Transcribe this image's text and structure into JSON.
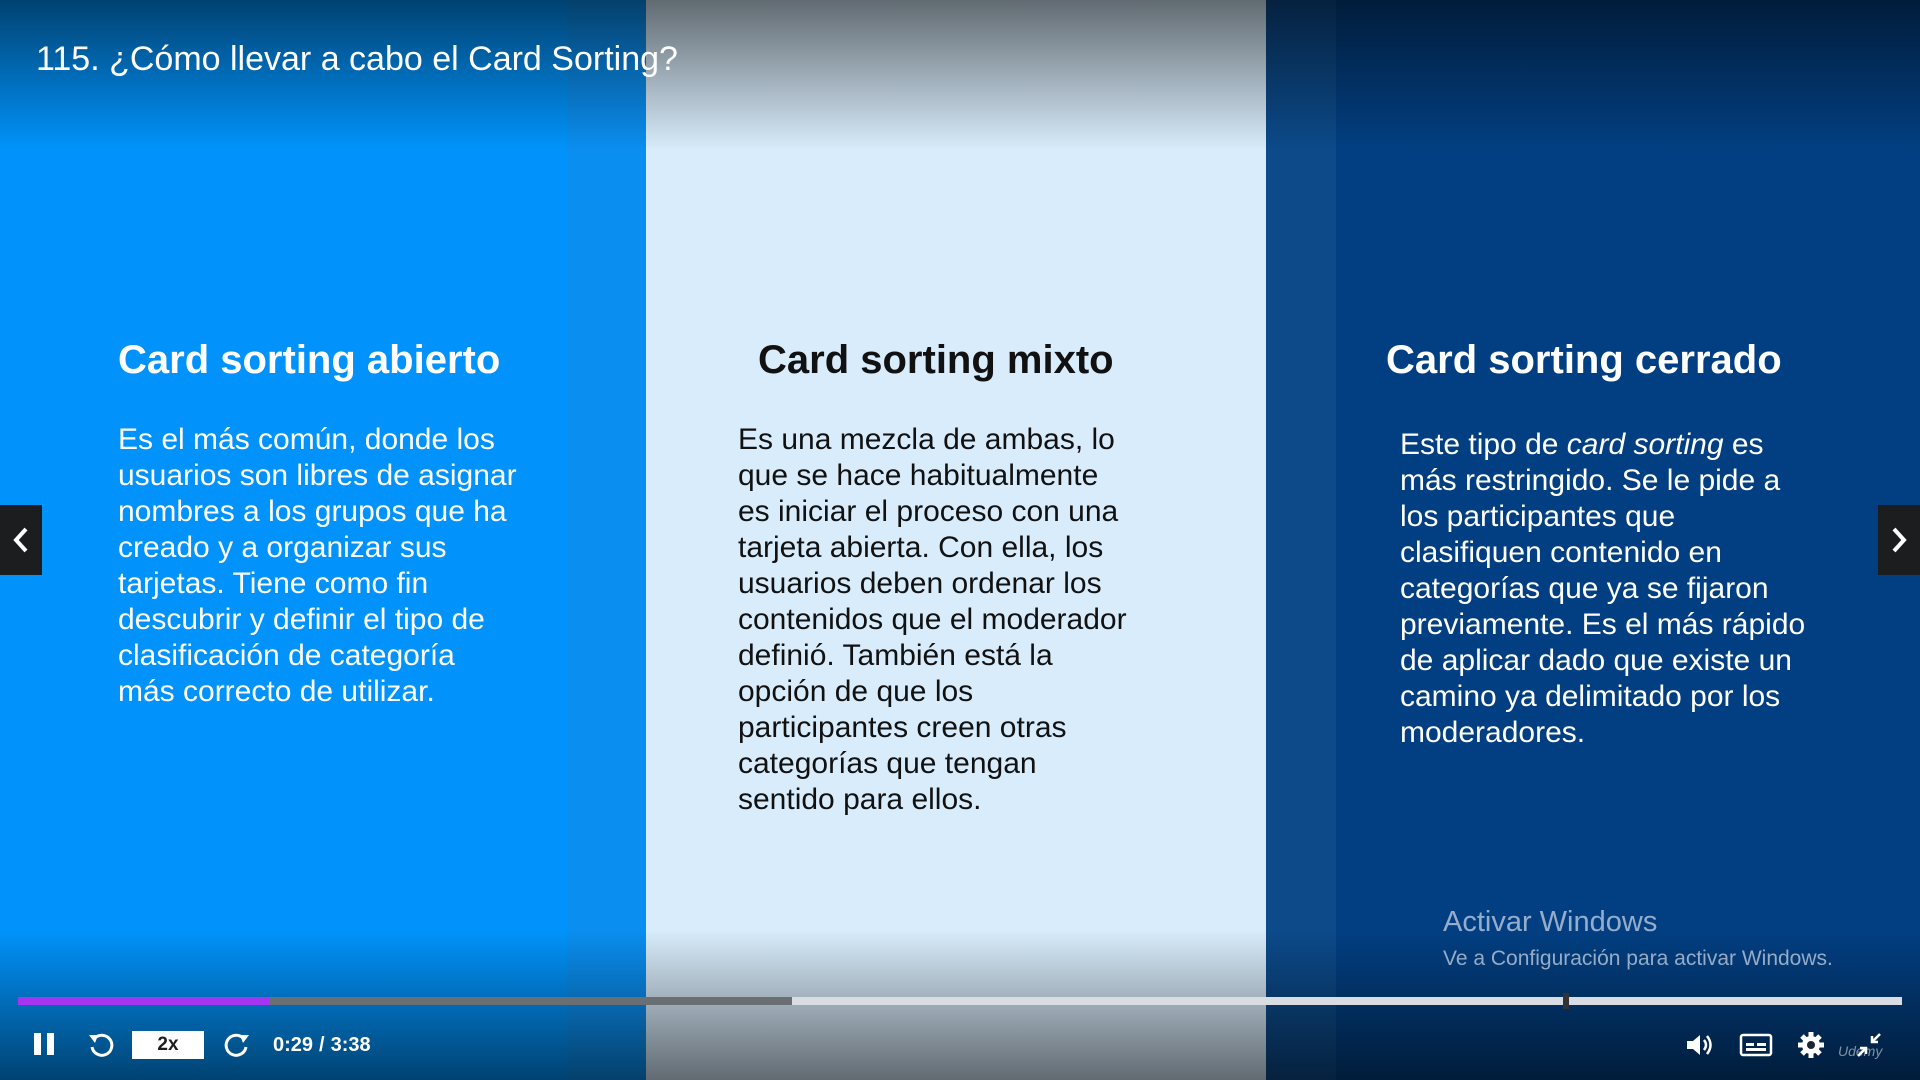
{
  "lecture": {
    "title": "115. ¿Cómo llevar a cabo el Card Sorting?"
  },
  "slide": {
    "open": {
      "title": "Card sorting abierto",
      "body": "Es el más común, donde los usuarios son libres de asignar nombres a los grupos que ha creado y a organizar sus tarjetas. Tiene como fin descubrir y definir el tipo de clasificación de categoría más correcto de utilizar."
    },
    "mixed": {
      "title": "Card sorting mixto",
      "body": "Es una mezcla de ambas, lo que se hace habitualmente es iniciar el proceso con una tarjeta abierta. Con ella, los usuarios deben ordenar los contenidos que el moderador definió. También está la opción de que los participantes creen otras categorías que tengan sentido para ellos."
    },
    "closed": {
      "title": "Card sorting cerrado",
      "body_prefix": "Este tipo de ",
      "body_emphasis": "card sorting",
      "body_suffix": " es más restringido. Se le pide a los participantes que clasifiquen contenido en categorías que ya se fijaron previamente. Es el más rápido de aplicar dado que existe un camino ya delimitado por los moderadores."
    },
    "colors": {
      "open": "#0193fb",
      "mixed": "#d8ecfb",
      "closed": "#023f82"
    }
  },
  "watermark": {
    "title": "Activar Windows",
    "subtitle": "Ve a Configuración para activar Windows."
  },
  "player": {
    "speed": "2x",
    "current_time": "0:29",
    "separator": "/",
    "duration": "3:38",
    "progress_played": 0.134,
    "progress_buffered": 0.411,
    "progress_marker": 0.82,
    "accent_color": "#a435f0",
    "brand": "Udemy",
    "icons": {
      "prev": "chevron-left-icon",
      "next": "chevron-right-icon",
      "pause": "pause-icon",
      "rewind": "rewind-icon",
      "forward": "forward-icon",
      "volume": "volume-icon",
      "captions": "captions-icon",
      "settings": "gear-icon",
      "fullscreen": "exit-fullscreen-icon"
    }
  }
}
